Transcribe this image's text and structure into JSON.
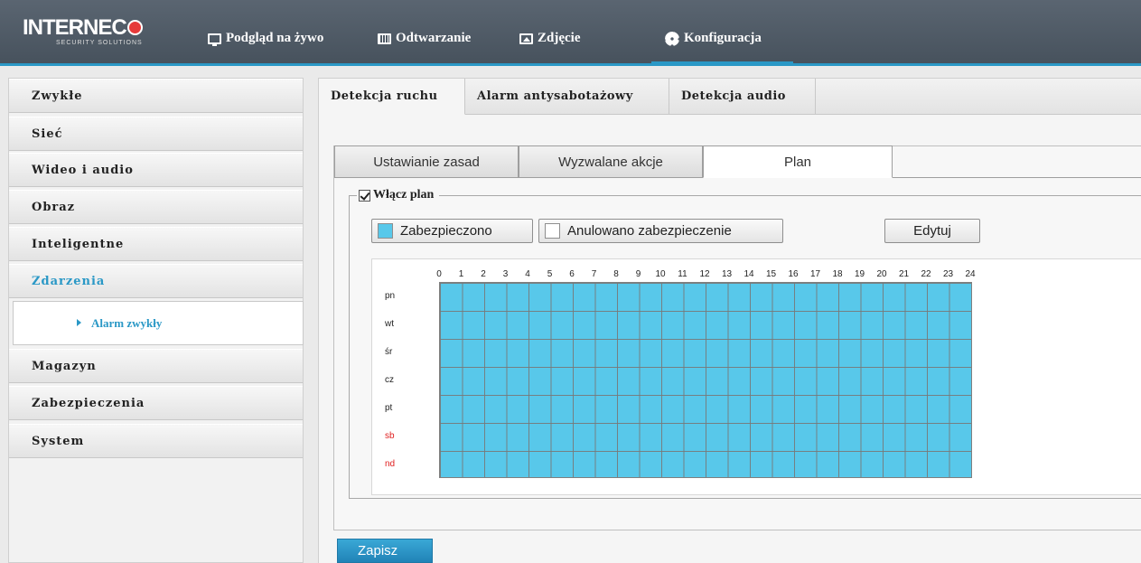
{
  "brand": {
    "logo_text": "INTERNEC",
    "logo_sub": "SECURITY SOLUTIONS"
  },
  "nav": {
    "live": "Podgląd na żywo",
    "playback": "Odtwarzanie",
    "photo": "Zdjęcie",
    "config": "Konfiguracja"
  },
  "sidebar": {
    "items": [
      "Zwykłe",
      "Sieć",
      "Wideo i audio",
      "Obraz",
      "Inteligentne",
      "Zdarzenia",
      "Magazyn",
      "Zabezpieczenia",
      "System"
    ],
    "active_item": "Zdarzenia",
    "sub_item": "Alarm zwykły"
  },
  "tabs_primary": [
    "Detekcja ruchu",
    "Alarm antysabotażowy",
    "Detekcja audio"
  ],
  "tabs_secondary": [
    "Ustawianie zasad",
    "Wyzwalane akcje",
    "Plan"
  ],
  "plan": {
    "enable_label": "Włącz plan",
    "enabled": true,
    "armed_label": "Zabezpieczono",
    "disarmed_label": "Anulowano zabezpieczenie",
    "edit_label": "Edytuj",
    "hours": [
      "0",
      "1",
      "2",
      "3",
      "4",
      "5",
      "6",
      "7",
      "8",
      "9",
      "10",
      "11",
      "12",
      "13",
      "14",
      "15",
      "16",
      "17",
      "18",
      "19",
      "20",
      "21",
      "22",
      "23",
      "24"
    ],
    "days": [
      "pn",
      "wt",
      "śr",
      "cz",
      "pt",
      "sb",
      "nd"
    ],
    "armed_color": "#58c8ea",
    "weekend_color": "#e02020"
  },
  "save_label": "Zapisz",
  "colors": {
    "accent": "#2a98c6",
    "header": "#4e5965"
  }
}
